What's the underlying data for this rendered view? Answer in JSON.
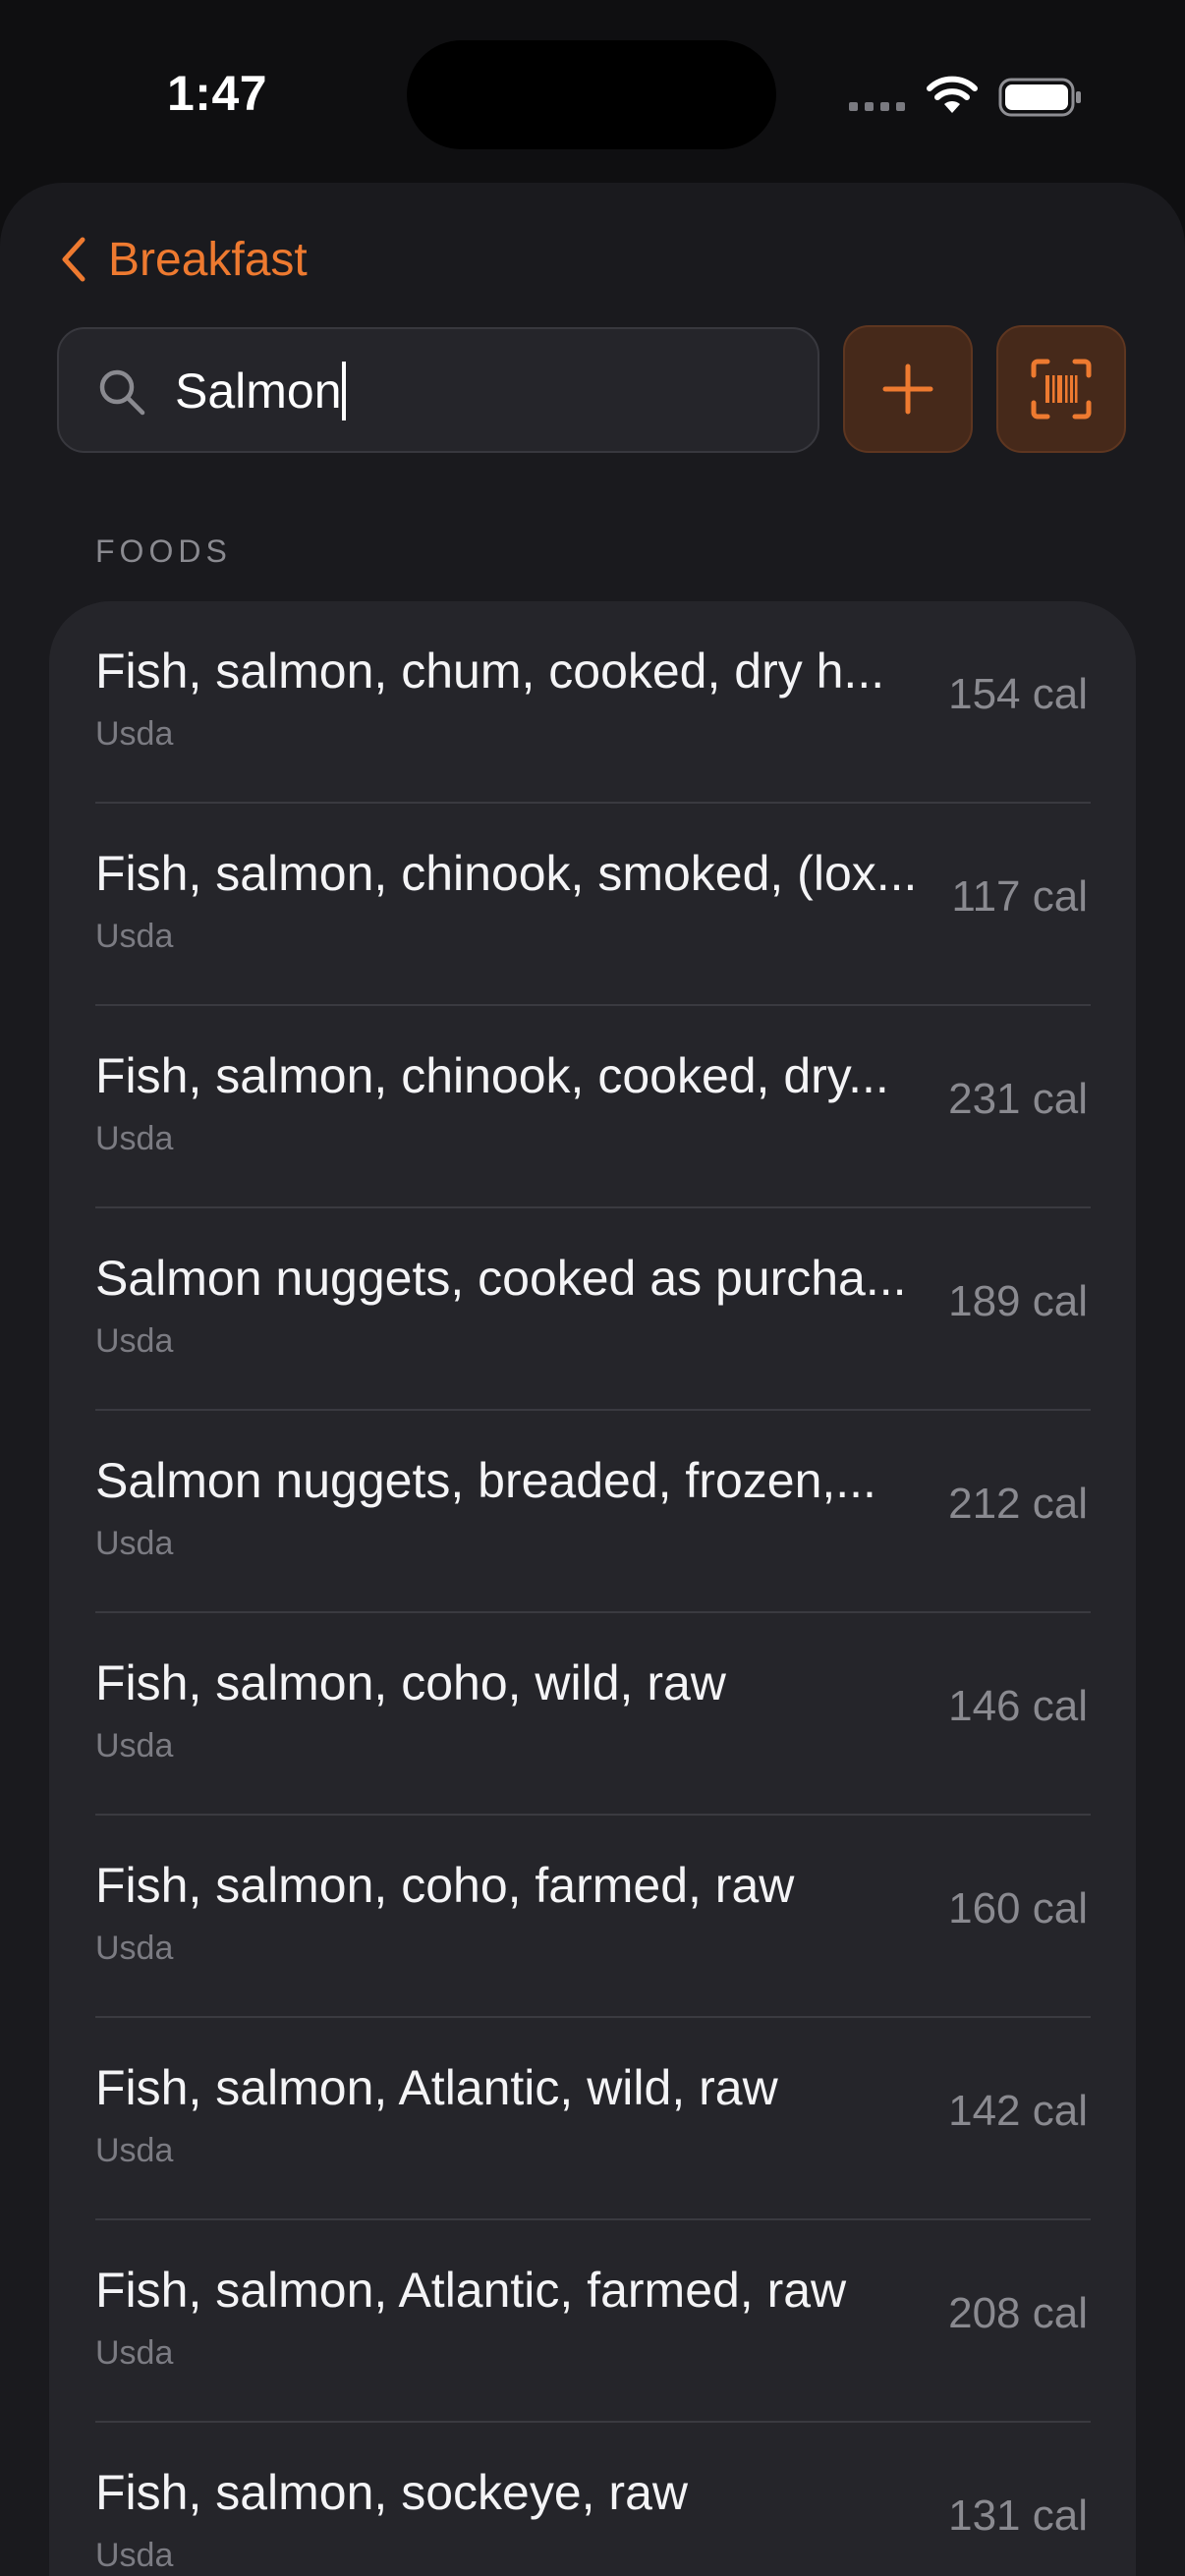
{
  "status_bar": {
    "time": "1:47",
    "icons": [
      "cellular-dots-icon",
      "wifi-icon",
      "battery-icon"
    ]
  },
  "header": {
    "back_label": "Breakfast",
    "back_icon": "chevron-left-icon"
  },
  "search": {
    "value": "Salmon",
    "icon": "search-icon"
  },
  "actions": {
    "add_icon": "plus-icon",
    "scan_icon": "barcode-scan-icon"
  },
  "section": {
    "title": "FOODS"
  },
  "foods": [
    {
      "name": "Fish, salmon, chum, cooked, dry h...",
      "source": "Usda",
      "calories": "154 cal"
    },
    {
      "name": "Fish, salmon, chinook, smoked, (lox...",
      "source": "Usda",
      "calories": "117 cal"
    },
    {
      "name": "Fish, salmon, chinook, cooked, dry...",
      "source": "Usda",
      "calories": "231 cal"
    },
    {
      "name": "Salmon nuggets, cooked as purcha...",
      "source": "Usda",
      "calories": "189 cal"
    },
    {
      "name": "Salmon nuggets, breaded, frozen,...",
      "source": "Usda",
      "calories": "212 cal"
    },
    {
      "name": "Fish, salmon, coho, wild, raw",
      "source": "Usda",
      "calories": "146 cal"
    },
    {
      "name": "Fish, salmon, coho, farmed, raw",
      "source": "Usda",
      "calories": "160 cal"
    },
    {
      "name": "Fish, salmon, Atlantic, wild, raw",
      "source": "Usda",
      "calories": "142 cal"
    },
    {
      "name": "Fish, salmon, Atlantic, farmed, raw",
      "source": "Usda",
      "calories": "208 cal"
    },
    {
      "name": "Fish, salmon, sockeye, raw",
      "source": "Usda",
      "calories": "131 cal"
    }
  ],
  "colors": {
    "accent": "#ee7a30",
    "background": "#0f0f11",
    "sheet": "#1a1a1e",
    "card": "#25252a"
  }
}
